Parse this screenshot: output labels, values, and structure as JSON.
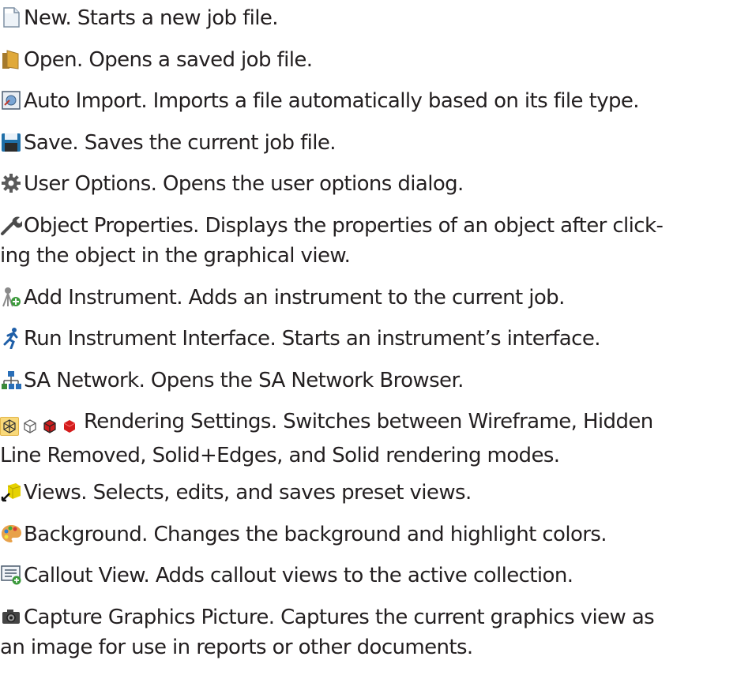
{
  "items": [
    {
      "icon": "new-file-icon",
      "text": "New. Starts a new job file."
    },
    {
      "icon": "open-folder-icon",
      "text": "Open. Opens a saved job file."
    },
    {
      "icon": "auto-import-icon",
      "text": "Auto Import. Imports a file automatically based on its file type."
    },
    {
      "icon": "save-floppy-icon",
      "text": "Save. Saves the current job file."
    },
    {
      "icon": "gear-icon",
      "text": "User Options. Opens the user options dialog."
    },
    {
      "icon": "wrench-icon",
      "text": "Object Properties. Displays the properties of an object after click-ing the object in the graphical view.",
      "line1": "Object Properties. Displays the properties of an object after click-",
      "line2": "ing the object in the graphical view."
    },
    {
      "icon": "add-instrument-icon",
      "text": "Add Instrument. Adds an instrument to the current job."
    },
    {
      "icon": "running-figure-icon",
      "text": "Run Instrument Interface. Starts an instrument’s interface."
    },
    {
      "icon": "network-icon",
      "text": "SA Network. Opens the SA Network Browser."
    },
    {
      "icon": "rendering-modes-icons",
      "text": "Rendering Settings. Switches between Wireframe, Hidden Line Removed, Solid+Edges, and Solid rendering modes.",
      "line1": "Rendering Settings. Switches between Wireframe, Hidden",
      "line2": "Line Removed, Solid+Edges, and Solid rendering modes."
    },
    {
      "icon": "views-cube-icon",
      "text": "Views. Selects, edits, and saves preset views."
    },
    {
      "icon": "palette-icon",
      "text": "Background. Changes the background and highlight colors."
    },
    {
      "icon": "callout-view-icon",
      "text": "Callout View. Adds callout views to the active collection."
    },
    {
      "icon": "camera-icon",
      "text": "Capture Graphics Picture. Captures the current graphics view as an image for use in reports or other documents.",
      "line1": "Capture Graphics Picture. Captures the current graphics view as",
      "line2": "an image for use in reports or other documents."
    }
  ]
}
